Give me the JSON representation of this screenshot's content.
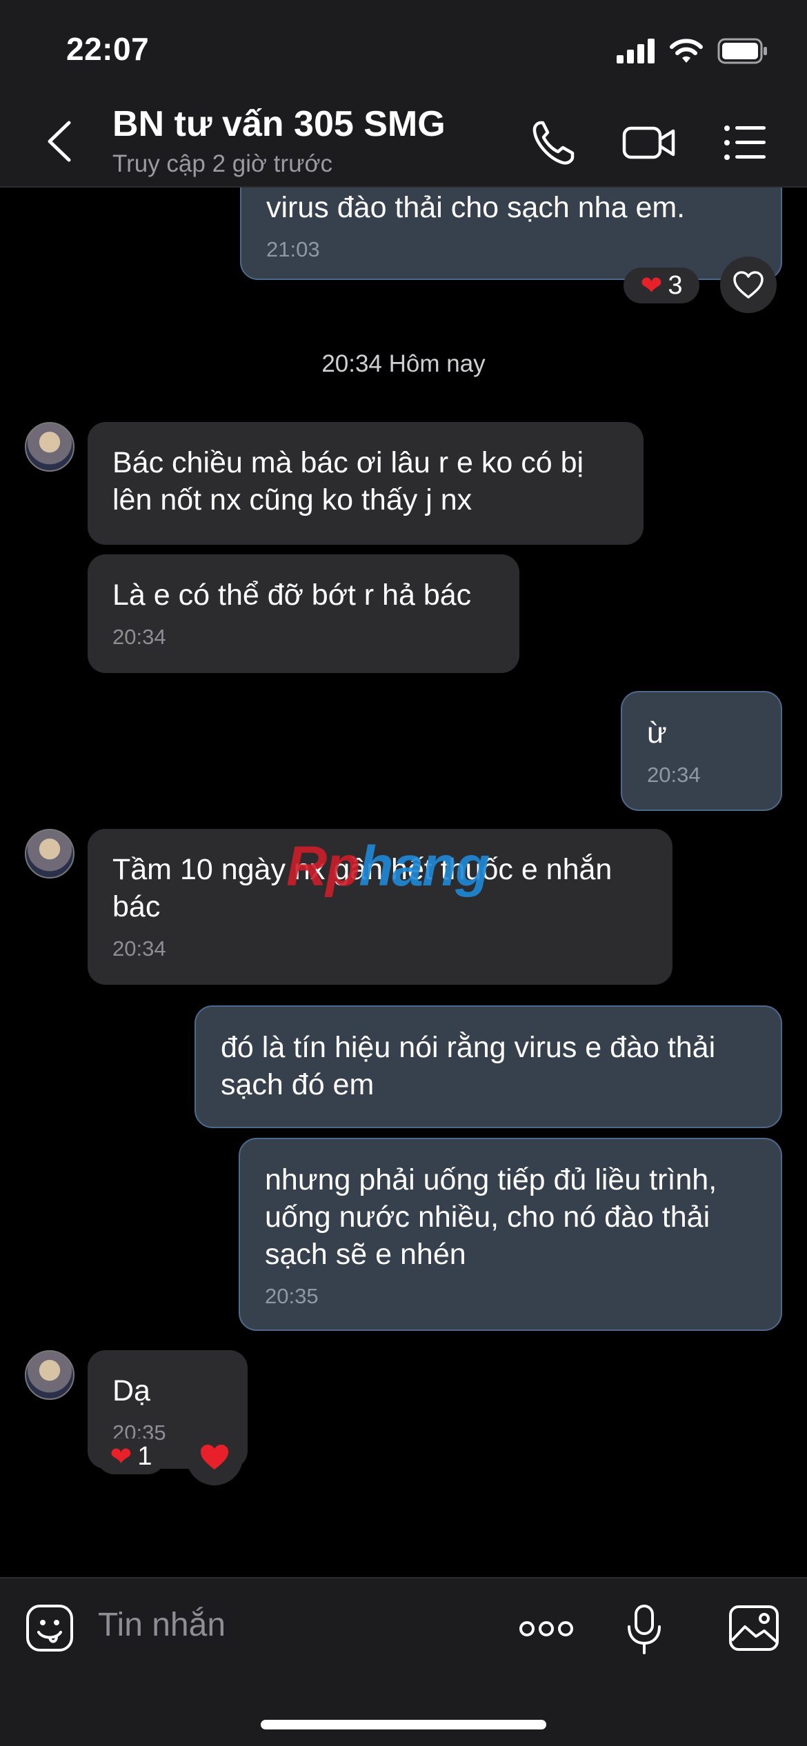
{
  "status_bar": {
    "time": "22:07"
  },
  "header": {
    "title": "BN tư vấn 305 SMG",
    "subtitle": "Truy cập 2 giờ trước"
  },
  "messages": [
    {
      "dir": "out",
      "text": "virus đào thải cho sạch nha em.",
      "time": "21:03",
      "reaction_count": "3"
    },
    {
      "dir": "in",
      "text": "Bác chiều mà bác ơi lâu r e ko có bị lên nốt nx cũng ko thấy j nx"
    },
    {
      "dir": "in",
      "text": "Là e có thể đỡ bớt r hả bác",
      "time": "20:34"
    },
    {
      "dir": "out",
      "text": "ừ",
      "time": "20:34"
    },
    {
      "dir": "in",
      "text": "Tầm 10 ngày nx gần hết thuốc e nhắn bác",
      "time": "20:34"
    },
    {
      "dir": "out",
      "text": "đó là tín hiệu nói rằng virus e đào thải sạch đó em"
    },
    {
      "dir": "out",
      "text": "nhưng phải uống tiếp đủ liều trình, uống nước nhiều, cho nó đào thải sạch sẽ e nhén",
      "time": "20:35"
    },
    {
      "dir": "in",
      "text": "Dạ",
      "time": "20:35",
      "reaction_count": "1"
    }
  ],
  "date_separator": "20:34 Hôm nay",
  "watermark": {
    "part1": "Rp",
    "part2": "hang"
  },
  "composer": {
    "placeholder": "Tin nhắn"
  },
  "colors": {
    "incoming_bubble": "#2c2c2e",
    "outgoing_bubble": "#37404d",
    "heart": "#e8202a"
  }
}
